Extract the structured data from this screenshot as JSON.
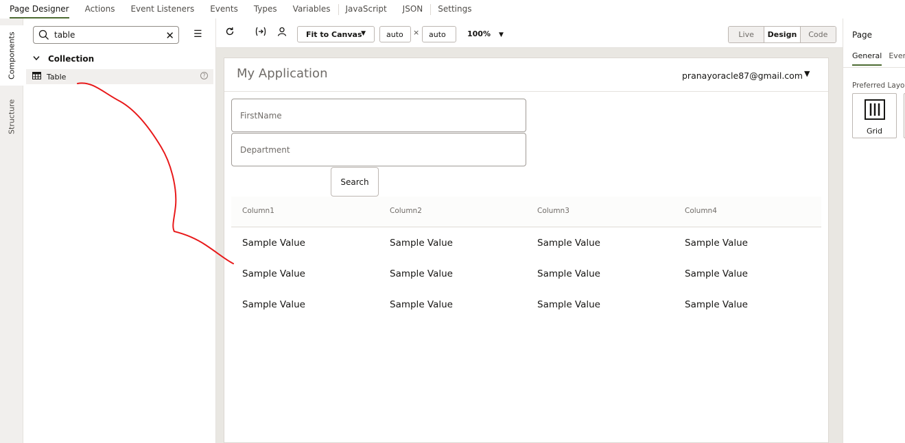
{
  "top_tabs": [
    "Page Designer",
    "Actions",
    "Event Listeners",
    "Events",
    "Types",
    "Variables",
    "JavaScript",
    "JSON",
    "Settings"
  ],
  "rail": {
    "components": "Components",
    "structure": "Structure"
  },
  "components_panel": {
    "search_value": "table",
    "group": "Collection",
    "item": "Table"
  },
  "toolbar": {
    "fit_label": "Fit to Canvas",
    "width": "auto",
    "height": "auto",
    "times": "×",
    "zoom": "100%",
    "modes": [
      "Live",
      "Design",
      "Code"
    ],
    "active_mode": "Design"
  },
  "app": {
    "title": "My Application",
    "user": "pranayoracle87@gmail.com",
    "firstname_placeholder": "FirstName",
    "department_placeholder": "Department",
    "search_button": "Search"
  },
  "table": {
    "columns": [
      "Column1",
      "Column2",
      "Column3",
      "Column4"
    ],
    "rows": [
      [
        "Sample Value",
        "Sample Value",
        "Sample Value",
        "Sample Value"
      ],
      [
        "Sample Value",
        "Sample Value",
        "Sample Value",
        "Sample Value"
      ],
      [
        "Sample Value",
        "Sample Value",
        "Sample Value",
        "Sample Value"
      ]
    ]
  },
  "properties": {
    "title": "Page",
    "tabs": [
      "General",
      "Even"
    ],
    "preferred_layout_label": "Preferred Layo",
    "layout_option": "Grid"
  },
  "colors": {
    "accent": "#4b6a30",
    "annotation": "#e8191a"
  }
}
